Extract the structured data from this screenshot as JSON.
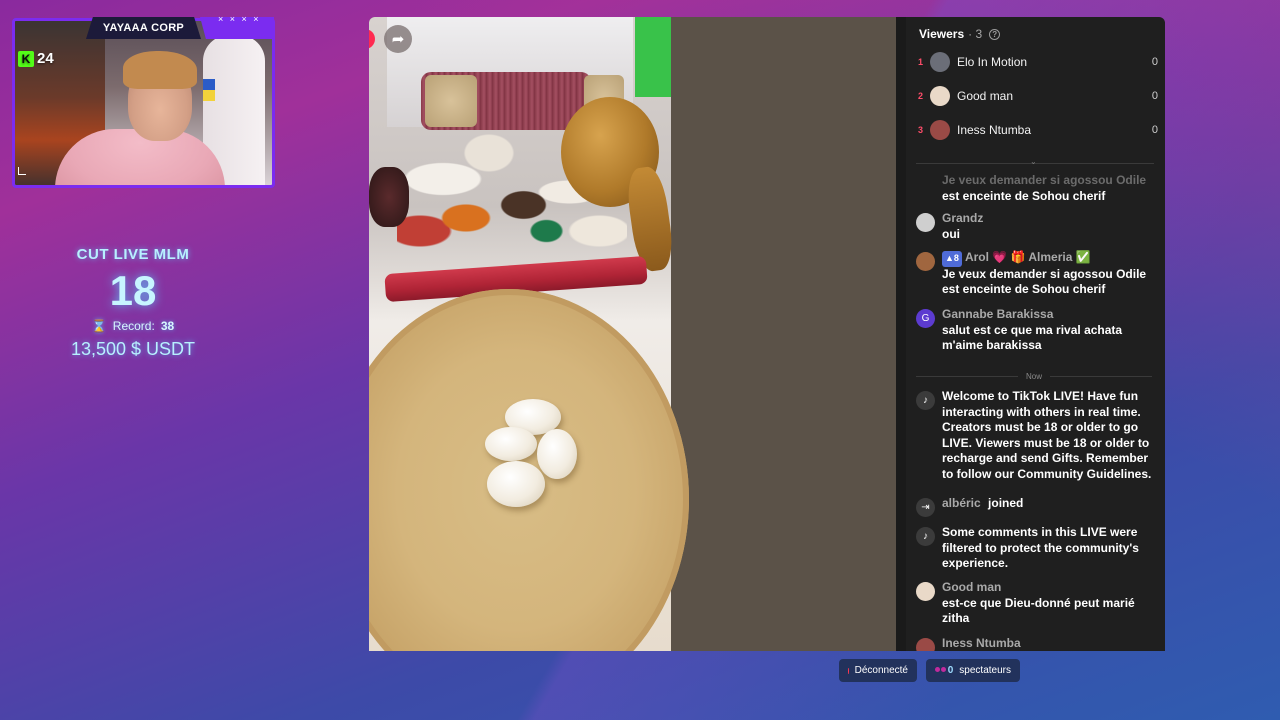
{
  "overlay": {
    "cam_title": "YAYAAA CORP",
    "cam_dots": "× × × ×",
    "kick_icon": "K",
    "kick_count": "24",
    "stats": {
      "label": "CUT LIVE MLM",
      "count": "18",
      "record_label": "Record:",
      "record_value": "38",
      "usdt": "13,500 $ USDT"
    }
  },
  "video": {
    "share_icon": "➦"
  },
  "chat": {
    "viewers_title": "Viewers",
    "viewers_count": "· 3",
    "help_icon": "?",
    "viewers": [
      {
        "rank": "1",
        "name": "Elo In Motion",
        "score": "0",
        "avatar_color": "#6b6e78"
      },
      {
        "rank": "2",
        "name": "Good man",
        "score": "0",
        "avatar_color": "#e9d9c8"
      },
      {
        "rank": "3",
        "name": "Iness Ntumba",
        "score": "0",
        "avatar_color": "#9a4a46"
      }
    ],
    "messages": [
      {
        "author": "Je veux demander si agossou Odile",
        "text": "est enceinte de Sohou cherif"
      },
      {
        "author": "Grandz",
        "text": "oui"
      },
      {
        "badge": "8",
        "author": "Arol 💗 🎁 Almeria ✅",
        "text": "Je veux demander si agossou Odile est enceinte de Sohou cherif"
      },
      {
        "author": "Gannabe Barakissa",
        "avatar_letter": "G",
        "text": "salut est ce que ma rival achata m'aime barakissa"
      }
    ],
    "now_label": "Now",
    "system": [
      {
        "icon": "♪",
        "text": "Welcome to TikTok LIVE! Have fun interacting with others in real time. Creators must be 18 or older to go LIVE. Viewers must be 18 or older to recharge and send Gifts. Remember to follow our Community Guidelines."
      },
      {
        "icon": "⇥",
        "author": "albéric",
        "text": "joined"
      },
      {
        "icon": "♪",
        "text": "Some comments in this LIVE were filtered to protect the community's experience."
      }
    ],
    "tail_messages": [
      {
        "author": "Good man",
        "text": "est-ce que Dieu-donné peut marié zitha"
      },
      {
        "author": "Iness Ntumba",
        "text": ""
      }
    ]
  },
  "bottom": {
    "status_label": "Déconnecté",
    "viewers_value": "0",
    "viewers_label": "spectateurs"
  },
  "colors": {
    "accent_purple": "#7b2cf0",
    "rank_red": "#ff4d6a",
    "kick_green": "#53fc18",
    "stat_glow": "#b8f0ff"
  }
}
